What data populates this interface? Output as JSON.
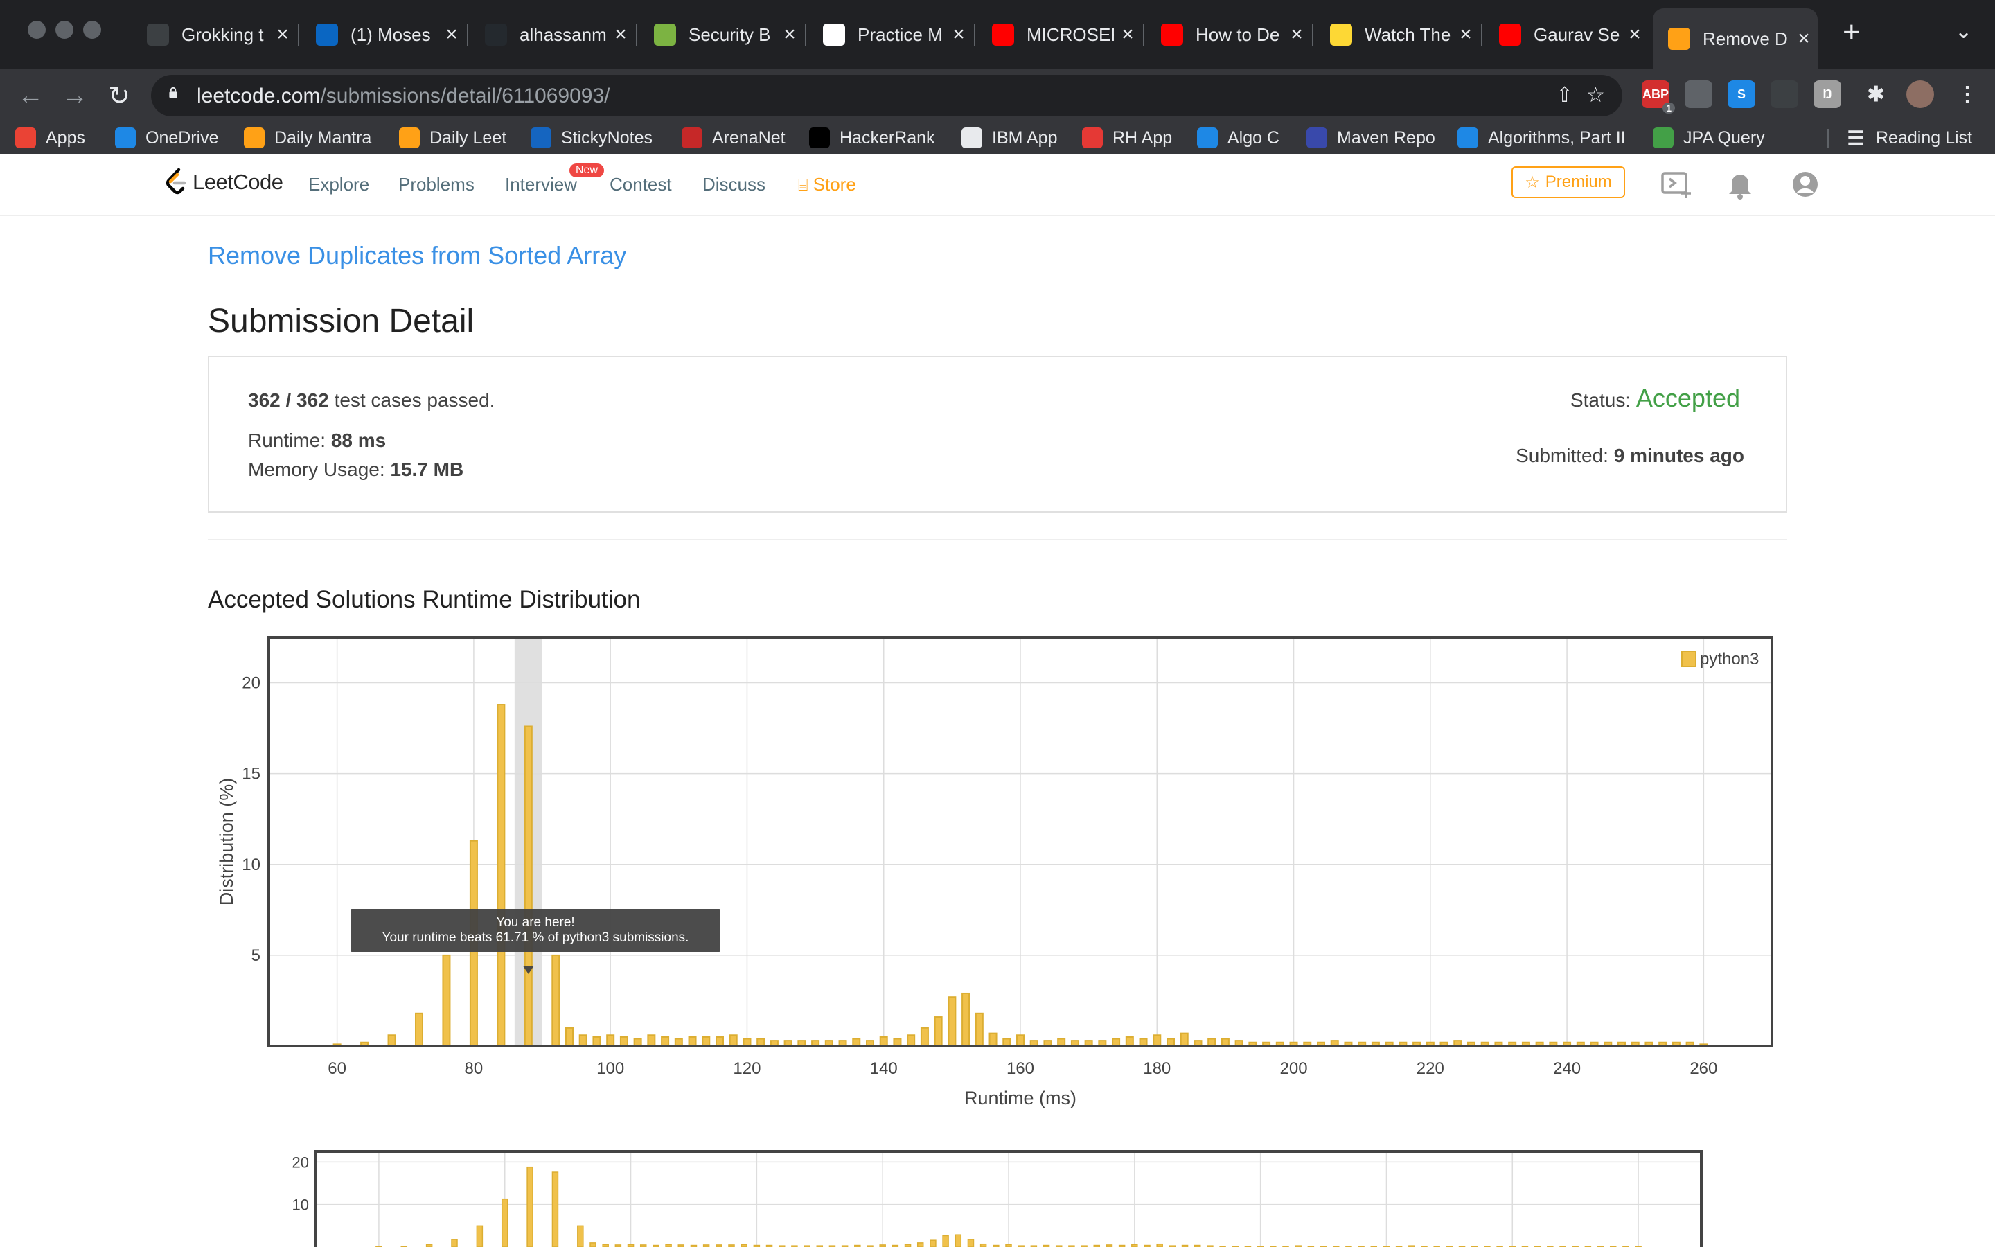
{
  "browser": {
    "tabs": [
      {
        "title": "Grokking t",
        "icon": "terminal-icon",
        "color": "#3c4043"
      },
      {
        "title": "(1) Moses",
        "icon": "linkedin-icon",
        "color": "#0a66c2"
      },
      {
        "title": "alhassanm",
        "icon": "github-icon",
        "color": "#24292e"
      },
      {
        "title": "Security B",
        "icon": "security-icon",
        "color": "#7cb342"
      },
      {
        "title": "Practice M",
        "icon": "checkmark-icon",
        "color": "#ffffff"
      },
      {
        "title": "MICROSEF",
        "icon": "youtube-icon",
        "color": "#ff0000"
      },
      {
        "title": "How to De",
        "icon": "youtube-icon",
        "color": "#ff0000"
      },
      {
        "title": "Watch The",
        "icon": "exclamation-icon",
        "color": "#fdd835"
      },
      {
        "title": "Gaurav Se",
        "icon": "youtube-icon",
        "color": "#ff0000"
      },
      {
        "title": "Remove D",
        "icon": "leetcode-icon",
        "color": "#ffa116"
      }
    ],
    "url_host": "leetcode.com",
    "url_path": "/submissions/detail/611069093/",
    "extensions": [
      {
        "name": "adblock-extension",
        "label": "ABP",
        "badge": "1",
        "color": "#d32f2f"
      },
      {
        "name": "extension-2",
        "label": "",
        "color": "#5f6368"
      },
      {
        "name": "extension-s",
        "label": "S",
        "color": "#1e88e5"
      },
      {
        "name": "extension-glasses",
        "label": "",
        "color": "#3c4043"
      },
      {
        "name": "extension-h",
        "label": "Ŋ",
        "color": "#9e9e9e"
      }
    ],
    "bookmarks": [
      {
        "label": "Apps",
        "icon": "apps-icon",
        "color": "#ea4335"
      },
      {
        "label": "OneDrive",
        "icon": "onedrive-icon",
        "color": "#1e88e5"
      },
      {
        "label": "Daily Mantra",
        "icon": "leetcode-icon",
        "color": "#ffa116"
      },
      {
        "label": "Daily Leet",
        "icon": "leetcode-icon",
        "color": "#ffa116"
      },
      {
        "label": "StickyNotes",
        "icon": "outlook-icon",
        "color": "#1565c0"
      },
      {
        "label": "ArenaNet",
        "icon": "arenanet-icon",
        "color": "#c62828"
      },
      {
        "label": "HackerRank",
        "icon": "hackerrank-icon",
        "color": "#000000"
      },
      {
        "label": "IBM App",
        "icon": "globe-icon",
        "color": "#e8eaed"
      },
      {
        "label": "RH App",
        "icon": "redhat-icon",
        "color": "#e53935"
      },
      {
        "label": "Algo C",
        "icon": "c-icon",
        "color": "#1e88e5"
      },
      {
        "label": "Maven Repo",
        "icon": "maven-icon",
        "color": "#3949ab"
      },
      {
        "label": "Algorithms, Part II",
        "icon": "c-icon",
        "color": "#1e88e5"
      },
      {
        "label": "JPA Query",
        "icon": "leaf-icon",
        "color": "#43a047"
      }
    ],
    "reading_list": "Reading List"
  },
  "nav": {
    "logo_text": "LeetCode",
    "links": [
      "Explore",
      "Problems",
      "Interview",
      "Contest",
      "Discuss"
    ],
    "new_badge": "New",
    "store": "Store",
    "premium": "Premium"
  },
  "problem_title": "Remove Duplicates from Sorted Array",
  "page_title": "Submission Detail",
  "result": {
    "passed": "362 / 362",
    "passed_suffix": "test cases passed.",
    "status_label": "Status:",
    "status": "Accepted",
    "runtime_label": "Runtime:",
    "runtime": "88 ms",
    "memory_label": "Memory Usage:",
    "memory": "15.7 MB",
    "submitted_label": "Submitted:",
    "submitted": "9 minutes ago"
  },
  "chart_title": "Accepted Solutions Runtime Distribution",
  "tooltip": {
    "line1": "You are here!",
    "line2": "Your runtime beats 61.71 % of python3 submissions."
  },
  "colors": {
    "bar": "#f0c14b",
    "bar_border": "#dcae32",
    "highlight": "#e0e0e0",
    "accepted": "#43a047",
    "link": "#3a90e5"
  },
  "chart_data": {
    "type": "bar",
    "xlabel": "Runtime (ms)",
    "ylabel": "Distribution (%)",
    "xlim": [
      50,
      270
    ],
    "ylim": [
      0,
      22.5
    ],
    "xticks": [
      60,
      80,
      100,
      120,
      140,
      160,
      180,
      200,
      220,
      240,
      260
    ],
    "yticks": [
      5,
      10,
      15,
      20
    ],
    "highlight_x": 88,
    "legend": "python3",
    "legend_position": "top-right",
    "series": [
      {
        "name": "python3",
        "x": [
          60,
          64,
          68,
          72,
          76,
          80,
          84,
          88,
          92,
          94,
          96,
          98,
          100,
          102,
          104,
          106,
          108,
          110,
          112,
          114,
          116,
          118,
          120,
          122,
          124,
          126,
          128,
          130,
          132,
          134,
          136,
          138,
          140,
          142,
          144,
          146,
          148,
          150,
          152,
          154,
          156,
          158,
          160,
          162,
          164,
          166,
          168,
          170,
          172,
          174,
          176,
          178,
          180,
          182,
          184,
          186,
          188,
          190,
          192,
          194,
          196,
          198,
          200,
          202,
          204,
          206,
          208,
          210,
          212,
          214,
          216,
          218,
          220,
          222,
          224,
          226,
          228,
          230,
          232,
          234,
          236,
          238,
          240,
          242,
          244,
          246,
          248,
          250,
          252,
          254,
          256,
          258,
          260
        ],
        "y": [
          0.1,
          0.2,
          0.6,
          1.8,
          5.0,
          11.3,
          18.8,
          17.6,
          5.0,
          1.0,
          0.6,
          0.5,
          0.6,
          0.5,
          0.4,
          0.6,
          0.5,
          0.4,
          0.5,
          0.5,
          0.5,
          0.6,
          0.4,
          0.4,
          0.3,
          0.3,
          0.3,
          0.3,
          0.3,
          0.3,
          0.4,
          0.3,
          0.5,
          0.4,
          0.6,
          1.0,
          1.6,
          2.7,
          2.9,
          1.8,
          0.7,
          0.4,
          0.6,
          0.3,
          0.3,
          0.4,
          0.3,
          0.3,
          0.3,
          0.4,
          0.5,
          0.4,
          0.6,
          0.4,
          0.7,
          0.3,
          0.4,
          0.4,
          0.3,
          0.2,
          0.2,
          0.2,
          0.2,
          0.2,
          0.2,
          0.3,
          0.2,
          0.2,
          0.2,
          0.2,
          0.2,
          0.2,
          0.2,
          0.2,
          0.3,
          0.2,
          0.2,
          0.2,
          0.2,
          0.2,
          0.2,
          0.2,
          0.2,
          0.2,
          0.2,
          0.2,
          0.2,
          0.2,
          0.2,
          0.2,
          0.2,
          0.2,
          0.1
        ]
      }
    ],
    "mini_yticks": [
      10,
      20
    ]
  }
}
